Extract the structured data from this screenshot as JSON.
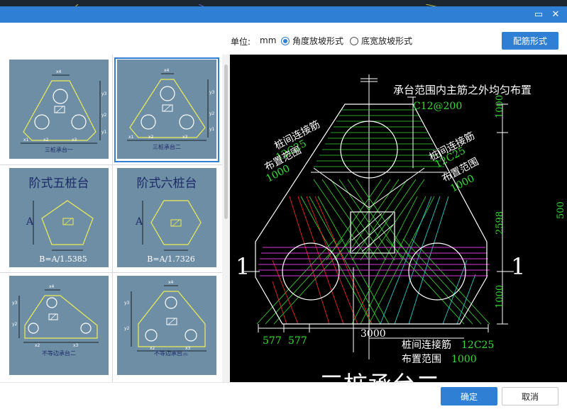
{
  "window": {
    "minimize_glyph": "▭",
    "close_glyph": "✕"
  },
  "toolbar": {
    "unit_label": "单位:",
    "unit_value": "mm",
    "options": [
      {
        "label": "角度放坡形式",
        "selected": true
      },
      {
        "label": "底宽放坡形式",
        "selected": false
      }
    ],
    "config_button": "配筋形式"
  },
  "gallery": {
    "items": [
      {
        "caption": "三桩承台一",
        "selected": false
      },
      {
        "caption": "三桩承台二",
        "selected": true
      },
      {
        "title": "阶式五桩台",
        "side_label": "A",
        "formula": "B=A/1.5385",
        "selected": false
      },
      {
        "title": "阶式六桩台",
        "side_label": "A",
        "formula": "B=A/1.7326",
        "selected": false
      },
      {
        "caption": "不等边承台二",
        "selected": false
      },
      {
        "caption": "不等边承台三",
        "selected": false
      }
    ],
    "dim_marks": [
      "x1",
      "x2",
      "x3",
      "x4",
      "y1",
      "y2",
      "y3"
    ]
  },
  "preview": {
    "top_note": "承台范围内主筋之外均匀布置",
    "top_rebar": "C12@200",
    "left_label_1": "桩间连接筋",
    "left_label_2": "12C25",
    "left_label_3": "布置范围",
    "left_label_4": "1000",
    "right_label_1": "桩间连接筋",
    "right_label_2": "12C25",
    "right_label_3": "布置范围",
    "right_label_4": "1000",
    "dim_right": [
      "1000",
      "2598",
      "1000"
    ],
    "dim_bottom_left_1": "577",
    "dim_bottom_left_2": "577",
    "dim_bottom_total": "3000",
    "bottom_label_1": "桩间连接筋",
    "bottom_label_2": "12C25",
    "bottom_label_3": "布置范围",
    "bottom_label_4": "1000",
    "section_mark": "1",
    "edge_dim": "500",
    "big_title": "三桩承台二"
  },
  "footer": {
    "ok": "确定",
    "cancel": "取消"
  },
  "colors": {
    "accent": "#2f7fd4",
    "thumb_bg": "#6e8ea6",
    "rebar_green": "#33dd33",
    "outline": "#ffffff",
    "rebar_magenta": "#dd33dd",
    "rebar_red": "#ee2222",
    "rebar_cyan": "#22cccc",
    "thumb_outline": "#eeee55"
  }
}
